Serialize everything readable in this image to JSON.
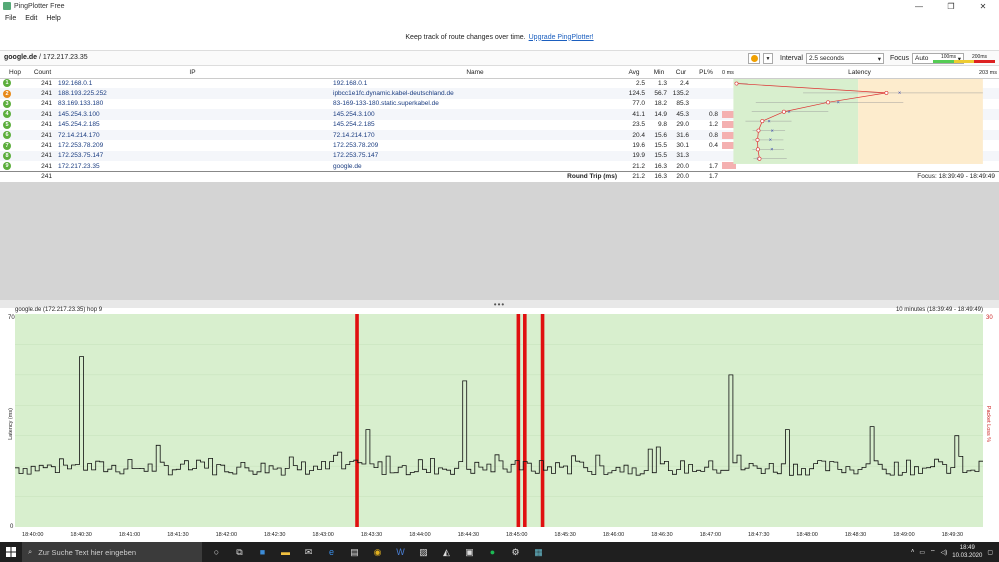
{
  "window": {
    "title": "PingPlotter Free",
    "controls": [
      "—",
      "❐",
      "✕"
    ]
  },
  "menu": [
    "File",
    "Edit",
    "Help"
  ],
  "banner": {
    "text": "Keep track of route changes over time.",
    "link": "Upgrade PingPlotter!"
  },
  "toolbar": {
    "target_name": "google.de",
    "target_ip": "/ 172.217.23.35",
    "interval_label": "Interval",
    "interval_value": "2.5 seconds",
    "focus_label": "Focus",
    "focus_value": "Auto",
    "legend_100": "100ms",
    "legend_200": "200ms"
  },
  "table": {
    "headers": {
      "hop": "Hop",
      "count": "Count",
      "ip": "IP",
      "name": "Name",
      "avg": "Avg",
      "min": "Min",
      "cur": "Cur",
      "pl": "PL%",
      "zero": "0 ms",
      "latency": "Latency",
      "max": "203 ms"
    },
    "rows": [
      {
        "hop": "1",
        "count": "241",
        "ip": "192.168.0.1",
        "name": "192.168.0.1",
        "avg": "2.5",
        "min": "1.3",
        "cur": "2.4",
        "pl": "",
        "color": "#5cae3c"
      },
      {
        "hop": "2",
        "count": "241",
        "ip": "188.193.225.252",
        "name": "ipbcc1e1fc.dynamic.kabel-deutschland.de",
        "avg": "124.5",
        "min": "56.7",
        "cur": "135.2",
        "pl": "",
        "color": "#e88a1a"
      },
      {
        "hop": "3",
        "count": "241",
        "ip": "83.169.133.180",
        "name": "83-169-133-180.static.superkabel.de",
        "avg": "77.0",
        "min": "18.2",
        "cur": "85.3",
        "pl": "",
        "color": "#5cae3c"
      },
      {
        "hop": "4",
        "count": "241",
        "ip": "145.254.3.100",
        "name": "145.254.3.100",
        "avg": "41.1",
        "min": "14.9",
        "cur": "45.3",
        "pl": "0.8",
        "color": "#5cae3c"
      },
      {
        "hop": "5",
        "count": "241",
        "ip": "145.254.2.185",
        "name": "145.254.2.185",
        "avg": "23.5",
        "min": "9.8",
        "cur": "29.0",
        "pl": "1.2",
        "color": "#5cae3c"
      },
      {
        "hop": "6",
        "count": "241",
        "ip": "72.14.214.170",
        "name": "72.14.214.170",
        "avg": "20.4",
        "min": "15.6",
        "cur": "31.6",
        "pl": "0.8",
        "color": "#5cae3c"
      },
      {
        "hop": "7",
        "count": "241",
        "ip": "172.253.78.209",
        "name": "172.253.78.209",
        "avg": "19.6",
        "min": "15.5",
        "cur": "30.1",
        "pl": "0.4",
        "color": "#5cae3c"
      },
      {
        "hop": "8",
        "count": "241",
        "ip": "172.253.75.147",
        "name": "172.253.75.147",
        "avg": "19.9",
        "min": "15.5",
        "cur": "31.3",
        "pl": "",
        "color": "#5cae3c"
      },
      {
        "hop": "9",
        "count": "241",
        "ip": "172.217.23.35",
        "name": "google.de",
        "avg": "21.2",
        "min": "16.3",
        "cur": "20.0",
        "pl": "1.7",
        "color": "#5cae3c"
      }
    ],
    "summary": {
      "count": "241",
      "label": "Round Trip (ms)",
      "avg": "21.2",
      "min": "16.3",
      "cur": "20.0",
      "pl": "1.7",
      "focus": "Focus: 18:39:49 - 18:49:49"
    }
  },
  "graph": {
    "title": "google.de (172.217.23.35) hop 9",
    "range": "10 minutes (18:39:49 - 18:49:49)",
    "ylabel": "Latency (ms)",
    "y2label": "Packet Loss %",
    "ymax_label": "70",
    "ymin_label": "0",
    "y2max_label": "30",
    "x_ticks": [
      "18:40:00",
      "18:40:30",
      "18:41:00",
      "18:41:30",
      "18:42:00",
      "18:42:30",
      "18:43:00",
      "18:43:30",
      "18:44:00",
      "18:44:30",
      "18:45:00",
      "18:45:30",
      "18:46:00",
      "18:46:30",
      "18:47:00",
      "18:47:30",
      "18:48:00",
      "18:48:30",
      "18:49:00",
      "18:49:30"
    ]
  },
  "taskbar": {
    "search_placeholder": "Zur Suche Text hier eingeben",
    "time": "18:49",
    "date": "10.03.2020"
  }
}
